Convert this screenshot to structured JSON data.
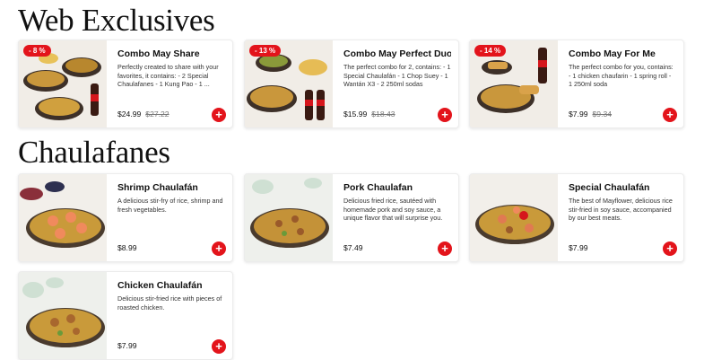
{
  "sections": [
    {
      "title": "Web Exclusives",
      "cards": [
        {
          "title": "Combo May Share",
          "desc": "Perfectly created to share with your favorites, it contains: - 2 Special Chaulafanes - 1 Kung Pao - 1 ...",
          "price": "$24.99",
          "old_price": "$27.22",
          "badge": "- 8 %",
          "image_icon": "combo-share-food-image",
          "add_label": "+"
        },
        {
          "title": "Combo May Perfect Duo",
          "desc": "The perfect combo for 2, contains: - 1 Special Chaulafán - 1 Chop Suey - 1 Wantán X3 - 2 250ml sodas",
          "price": "$15.99",
          "old_price": "$18.43",
          "badge": "- 13 %",
          "image_icon": "combo-duo-food-image",
          "add_label": "+"
        },
        {
          "title": "Combo May For Me",
          "desc": "The perfect combo for you, contains: - 1 chicken chaufarin - 1 spring roll - 1 250ml soda",
          "price": "$7.99",
          "old_price": "$9.34",
          "badge": "- 14 %",
          "image_icon": "combo-for-me-food-image",
          "add_label": "+"
        }
      ]
    },
    {
      "title": "Chaulafanes",
      "cards": [
        {
          "title": "Shrimp Chaulafán",
          "desc": "A delicious stir-fry of rice, shrimp and fresh vegetables.",
          "price": "$8.99",
          "image_icon": "shrimp-rice-image",
          "add_label": "+"
        },
        {
          "title": "Pork Chaulafan",
          "desc": "Delicious fried rice, sautéed with homemade pork and soy sauce, a unique flavor that will surprise you.",
          "price": "$7.49",
          "image_icon": "pork-rice-image",
          "add_label": "+"
        },
        {
          "title": "Special Chaulafán",
          "desc": "The best of Mayflower, delicious rice stir-fried in soy sauce, accompanied by our best meats.",
          "price": "$7.99",
          "image_icon": "special-rice-image",
          "add_label": "+"
        },
        {
          "title": "Chicken Chaulafán",
          "desc": "Delicious stir-fried rice with pieces of roasted chicken.",
          "price": "$7.99",
          "image_icon": "chicken-rice-image",
          "add_label": "+"
        }
      ]
    }
  ],
  "colors": {
    "accent": "#e3141b",
    "rice": "#c99a3a",
    "plate": "#5b4a3a"
  }
}
